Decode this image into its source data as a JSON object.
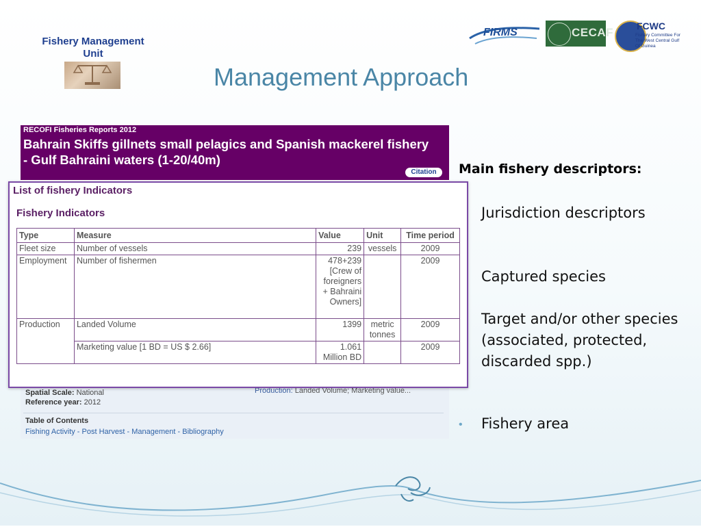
{
  "logo": {
    "title": "Fishery Management\nUnit"
  },
  "slide_title": "Management Approach",
  "partner_logos": {
    "firms": "FIRMS",
    "cecaf": "CECAF",
    "fcwc": "FCWC",
    "fcwc_sub": "Fishery Committee For The West Central Gulf Of Guinea"
  },
  "report": {
    "series": "RECOFI Fisheries Reports 2012",
    "title": "Bahrain Skiffs gillnets small pelagics and Spanish mackerel fishery - Gulf Bahraini waters (1-20/40m)",
    "citation_label": "Citation",
    "spatial_scale_label": "Spatial Scale:",
    "spatial_scale_value": "National",
    "reference_year_label": "Reference year:",
    "reference_year_value": "2012",
    "production_label": "Production:",
    "production_value": "Landed Volume; Marketing value...",
    "toc_heading": "Table of Contents",
    "toc": "Fishing Activity - Post Harvest - Management - Bibliography"
  },
  "indicators": {
    "heading": "List of fishery Indicators",
    "subheading": "Fishery Indicators",
    "columns": [
      "Type",
      "Measure",
      "Value",
      "Unit",
      "Time period"
    ],
    "rows": [
      {
        "type": "Fleet size",
        "measure": "Number of vessels",
        "value": "239",
        "unit": "vessels",
        "period": "2009"
      },
      {
        "type": "Employment",
        "measure": "Number of fishermen",
        "value": "478+239 [Crew of foreigners + Bahraini Owners]",
        "unit": "",
        "period": "2009"
      },
      {
        "type": "Production",
        "measure": "Landed Volume",
        "value": "1399",
        "unit": "metric tonnes",
        "period": "2009"
      },
      {
        "type": "",
        "measure": "Marketing value [1 BD = US $ 2.66]",
        "value": "1.061 Million BD",
        "unit": "",
        "period": "2009"
      }
    ]
  },
  "descriptors": {
    "heading": "Main fishery descriptors:",
    "items": [
      "Jurisdiction descriptors",
      "Captured species",
      "Target and/or other species (associated, protected, discarded spp.)",
      "Fishery area"
    ],
    "bullet": "•"
  }
}
